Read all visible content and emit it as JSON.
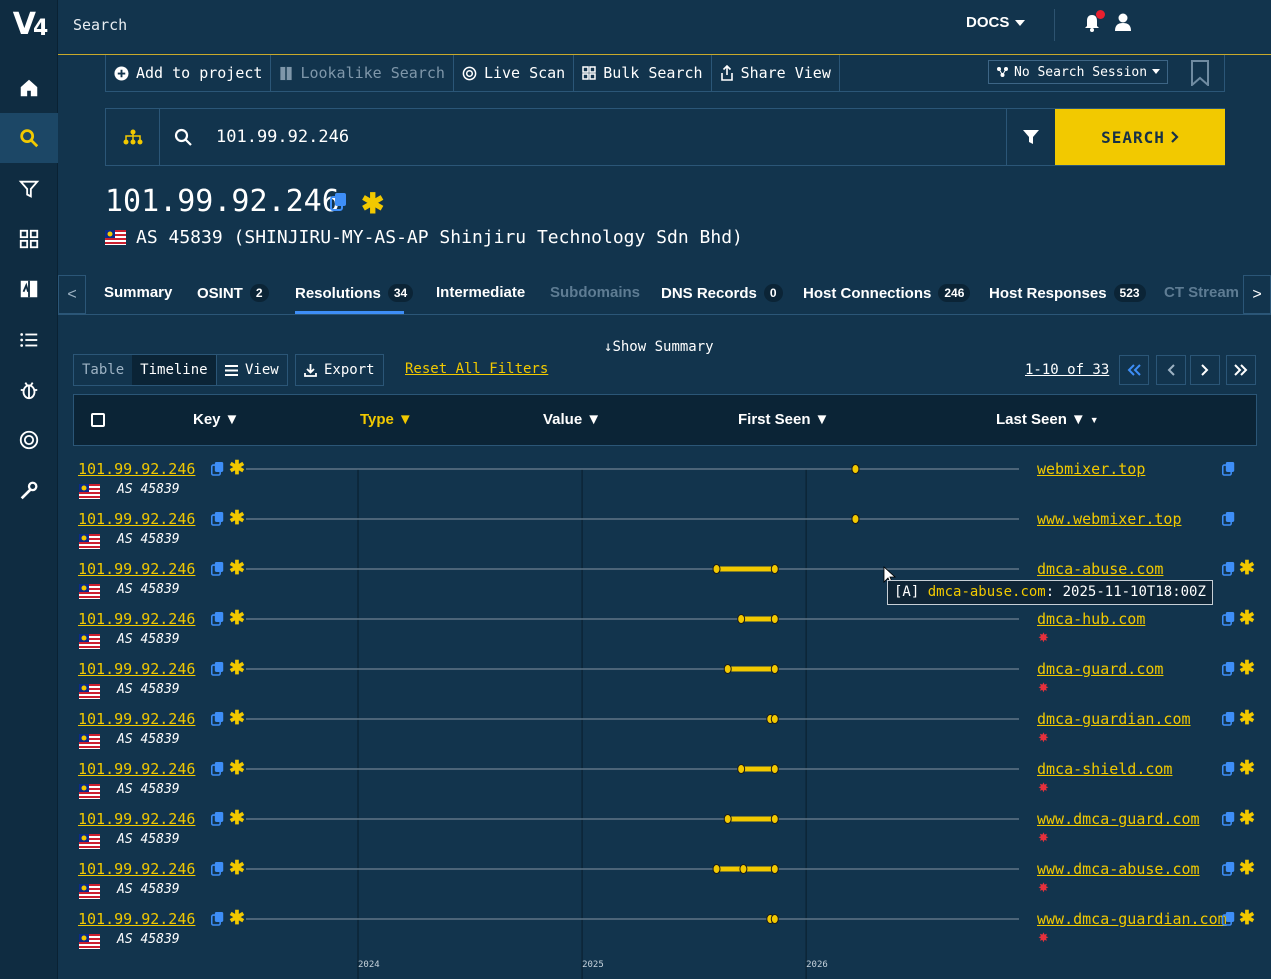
{
  "app": {
    "logo_text": "V",
    "title": "Search",
    "docs_label": "DOCS"
  },
  "toolbar": {
    "add_to_project": "Add to project",
    "lookalike_search": "Lookalike Search",
    "live_scan": "Live Scan",
    "bulk_search": "Bulk Search",
    "share_view": "Share View",
    "session": "No Search Session"
  },
  "search": {
    "query": "101.99.92.246",
    "button": "SEARCH"
  },
  "entity": {
    "title": "101.99.92.246",
    "as": "AS 45839 (SHINJIRU-MY-AS-AP Shinjiru Technology Sdn Bhd)"
  },
  "tabs": [
    {
      "label": "Summary",
      "count": ""
    },
    {
      "label": "OSINT",
      "count": "2"
    },
    {
      "label": "Resolutions",
      "count": "34"
    },
    {
      "label": "Intermediate",
      "count": ""
    },
    {
      "label": "Subdomains",
      "count": ""
    },
    {
      "label": "DNS Records",
      "count": "0"
    },
    {
      "label": "Host Connections",
      "count": "246"
    },
    {
      "label": "Host Responses",
      "count": "523"
    },
    {
      "label": "CT Stream",
      "count": ""
    }
  ],
  "controls": {
    "show_summary": "Show Summary",
    "table": "Table",
    "timeline": "Timeline",
    "view": "View",
    "export": "Export",
    "reset": "Reset All Filters",
    "page_info": "1-10 of 33"
  },
  "columns": {
    "key": "Key",
    "type": "Type",
    "value": "Value",
    "first_seen": "First Seen",
    "last_seen": "Last Seen"
  },
  "timeline_axis": {
    "start_year": 2023.5,
    "end_year": 2026.95,
    "ticks": [
      "2024",
      "2025",
      "2026"
    ]
  },
  "rows": [
    {
      "key": "101.99.92.246",
      "as": "AS 45839",
      "value": "webmixer.top",
      "starred": false,
      "flagged": false,
      "first": 2026.22,
      "last": 2026.22,
      "mid": null
    },
    {
      "key": "101.99.92.246",
      "as": "AS 45839",
      "value": "www.webmixer.top",
      "starred": false,
      "flagged": false,
      "first": 2026.22,
      "last": 2026.22,
      "mid": null
    },
    {
      "key": "101.99.92.246",
      "as": "AS 45839",
      "value": "dmca-abuse.com",
      "starred": true,
      "flagged": false,
      "first": 2025.6,
      "last": 2025.86,
      "mid": null
    },
    {
      "key": "101.99.92.246",
      "as": "AS 45839",
      "value": "dmca-hub.com",
      "starred": true,
      "flagged": true,
      "first": 2025.71,
      "last": 2025.86,
      "mid": null
    },
    {
      "key": "101.99.92.246",
      "as": "AS 45839",
      "value": "dmca-guard.com",
      "starred": true,
      "flagged": true,
      "first": 2025.65,
      "last": 2025.86,
      "mid": null
    },
    {
      "key": "101.99.92.246",
      "as": "AS 45839",
      "value": "dmca-guardian.com",
      "starred": true,
      "flagged": true,
      "first": 2025.84,
      "last": 2025.86,
      "mid": null
    },
    {
      "key": "101.99.92.246",
      "as": "AS 45839",
      "value": "dmca-shield.com",
      "starred": true,
      "flagged": true,
      "first": 2025.71,
      "last": 2025.86,
      "mid": null
    },
    {
      "key": "101.99.92.246",
      "as": "AS 45839",
      "value": "www.dmca-guard.com",
      "starred": true,
      "flagged": true,
      "first": 2025.65,
      "last": 2025.86,
      "mid": null
    },
    {
      "key": "101.99.92.246",
      "as": "AS 45839",
      "value": "www.dmca-abuse.com",
      "starred": true,
      "flagged": true,
      "first": 2025.6,
      "last": 2025.86,
      "mid": 2025.72
    },
    {
      "key": "101.99.92.246",
      "as": "AS 45839",
      "value": "www.dmca-guardian.com",
      "starred": true,
      "flagged": true,
      "first": 2025.84,
      "last": 2025.86,
      "mid": null
    }
  ],
  "tooltip": {
    "prefix": "[A]",
    "domain": "dmca-abuse.com",
    "separator": ":",
    "date": "2025-11-10T18:00Z"
  },
  "colors": {
    "accent": "#f2c900",
    "link_blue": "#3e8ef7",
    "alert_red": "#e8303c",
    "background": "#12344d"
  }
}
